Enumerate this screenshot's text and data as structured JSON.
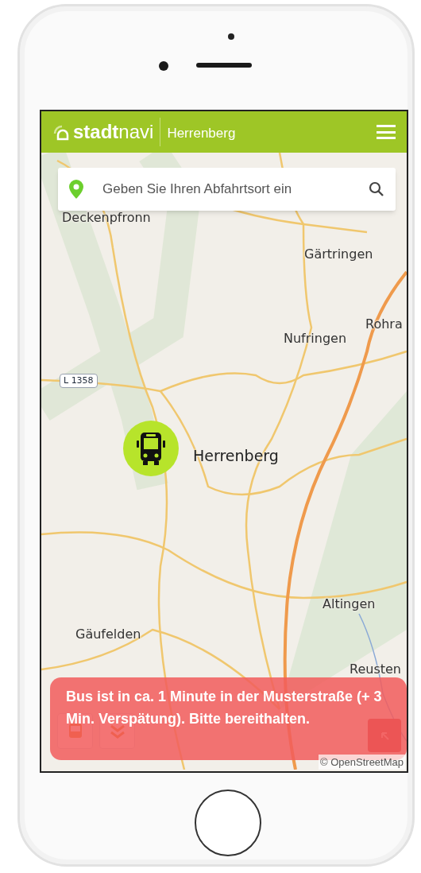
{
  "header": {
    "logo_bold": "stadt",
    "logo_light": "navi",
    "city": "Herrenberg"
  },
  "search": {
    "placeholder": "Geben Sie Ihren Abfahrtsort ein"
  },
  "map": {
    "labels": [
      {
        "text": "Deckenpfronn",
        "kind": "place"
      },
      {
        "text": "Gärtringen",
        "kind": "place"
      },
      {
        "text": "Rohra",
        "kind": "place"
      },
      {
        "text": "Nufringen",
        "kind": "place"
      },
      {
        "text": "L 1358",
        "kind": "road"
      },
      {
        "text": "Herrenberg",
        "kind": "town"
      },
      {
        "text": "Altingen",
        "kind": "place"
      },
      {
        "text": "Gäufelden",
        "kind": "place"
      },
      {
        "text": "Reusten",
        "kind": "place"
      }
    ],
    "attribution": "© OpenStreetMap"
  },
  "notification": {
    "text": "Bus ist in ca. 1 Minute in der Musterstraße (+ 3 Min. Verspätung). Bitte bereithalten."
  }
}
